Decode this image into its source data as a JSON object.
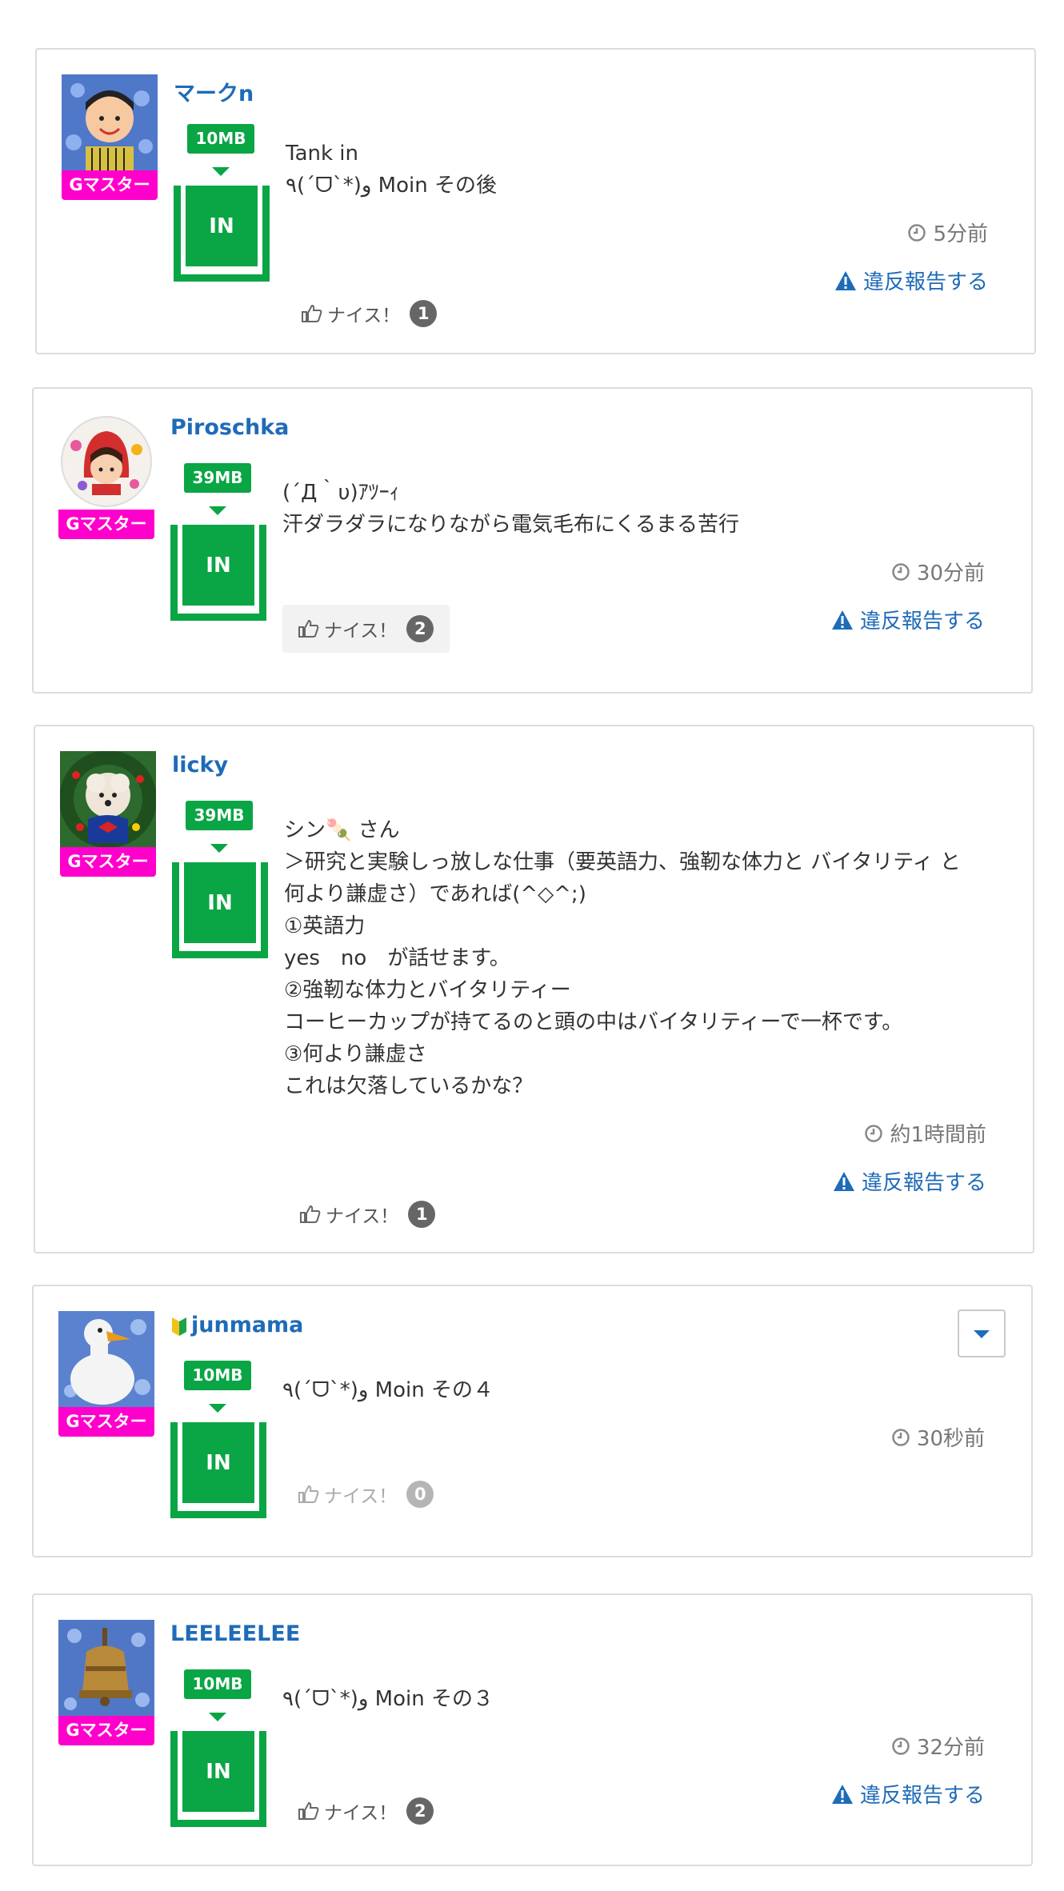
{
  "badge_label": "Gマスター",
  "in_label": "IN",
  "nice_label": "ナイス！",
  "report_label": "違反報告する",
  "posts": [
    {
      "username": "マークn",
      "mb": "10MB",
      "body": "Tank in\n٩(´ᗜ`*)و Moin その後",
      "time": "5分前",
      "nice_count": "1",
      "avatar": "smiling-man-avatar"
    },
    {
      "username": "Piroschka",
      "mb": "39MB",
      "body": "(´Д｀υ)ｱﾂｰｨ\n汗ダラダラになりながら電気毛布にくるまる苦行",
      "time": "30分前",
      "nice_count": "2",
      "avatar": "red-hood-girl-avatar"
    },
    {
      "username": "licky",
      "mb": "39MB",
      "body": "シン🍡 さん\n＞研究と実験しっ放しな仕事（要英語力、強靭な体力と バイタリティ と\n何より謙虚さ）であれば(^◇^;)\n①英語力\nyes　no　が話せます。\n②強靭な体力とバイタリティー\nコーヒーカップが持てるのと頭の中はバイタリティーで一杯です。\n③何より謙虚さ\nこれは欠落しているかな？",
      "time": "約1時間前",
      "nice_count": "1",
      "avatar": "dog-wreath-avatar"
    },
    {
      "username": "junmama",
      "mb": "10MB",
      "body": "٩(´ᗜ`*)و Moin その４",
      "time": "30秒前",
      "nice_count": "0",
      "avatar": "goose-avatar"
    },
    {
      "username": "LEELEELEE",
      "mb": "10MB",
      "body": "٩(´ᗜ`*)و Moin その３",
      "time": "32分前",
      "nice_count": "2",
      "avatar": "bell-avatar"
    }
  ],
  "colors": {
    "accent_blue": "#1e6bb8",
    "green": "#0aa544",
    "magenta": "#ff00cc"
  }
}
